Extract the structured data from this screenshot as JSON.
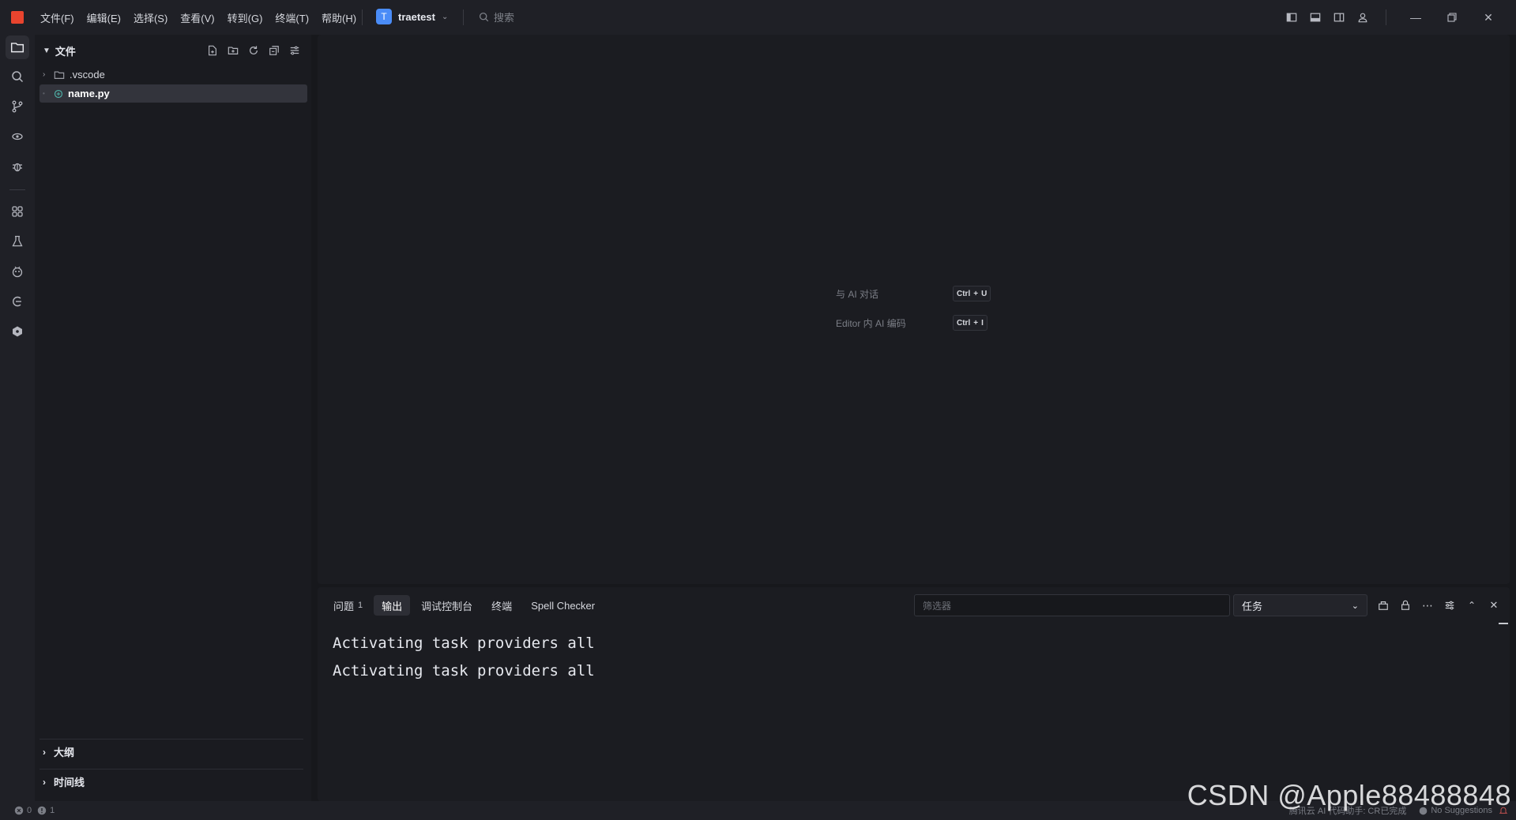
{
  "menu": [
    "文件(F)",
    "编辑(E)",
    "选择(S)",
    "查看(V)",
    "转到(G)",
    "终端(T)",
    "帮助(H)"
  ],
  "project": {
    "avatar": "T",
    "name": "traetest"
  },
  "search": {
    "placeholder": "搜索"
  },
  "sidebar": {
    "title": "文件",
    "tree": [
      {
        "name": ".vscode",
        "type": "folder"
      },
      {
        "name": "name.py",
        "type": "file"
      }
    ],
    "sections": [
      "大纲",
      "时间线"
    ]
  },
  "editor": {
    "hints": [
      {
        "label": "与 AI 对话",
        "keys": [
          "Ctrl",
          "+",
          "U"
        ]
      },
      {
        "label": "Editor 内 AI 编码",
        "keys": [
          "Ctrl",
          "+",
          "I"
        ]
      }
    ]
  },
  "panel": {
    "tabs": [
      {
        "label": "问题",
        "badge": "1"
      },
      {
        "label": "输出"
      },
      {
        "label": "调试控制台"
      },
      {
        "label": "终端"
      },
      {
        "label": "Spell Checker"
      }
    ],
    "active_tab": "输出",
    "filter_placeholder": "筛选器",
    "select_value": "任务",
    "output": [
      "Activating task providers all",
      "Activating task providers all"
    ]
  },
  "status": {
    "errors": "0",
    "warnings": "1",
    "right_left": "腾讯云 AI 代码助手: CR已完成",
    "right_right": "No Suggestions"
  },
  "watermark": "CSDN @Apple88488848",
  "colors": {
    "accent": "#4a8cf7",
    "logo": "#e8442e",
    "bg": "#17181c"
  }
}
